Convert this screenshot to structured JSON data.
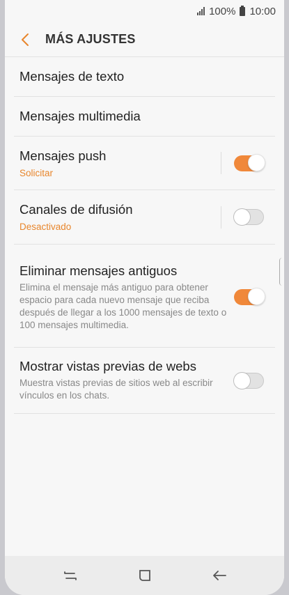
{
  "status_bar": {
    "battery_text": "100%",
    "time": "10:00"
  },
  "header": {
    "title": "MÁS AJUSTES",
    "back_icon": "chevron-left-icon"
  },
  "accent_color": "#f0883a",
  "settings": {
    "text_messages": {
      "title": "Mensajes de texto"
    },
    "multimedia_messages": {
      "title": "Mensajes multimedia"
    },
    "push_messages": {
      "title": "Mensajes push",
      "subtitle": "Solicitar",
      "enabled": true
    },
    "broadcast_channels": {
      "title": "Canales de difusión",
      "subtitle": "Desactivado",
      "enabled": false
    },
    "delete_old_messages": {
      "title": "Eliminar mensajes antiguos",
      "description": "Elimina el mensaje más antiguo para obtener espacio para cada nuevo mensaje que reciba después de llegar a los 1000 mensajes de texto o 100 mensajes multimedia.",
      "enabled": true
    },
    "web_previews": {
      "title": "Mostrar vistas previas de webs",
      "description": "Muestra vistas previas de sitios web al escribir vínculos en los chats.",
      "enabled": false
    }
  },
  "nav_bar": {
    "icons": [
      "recent-apps-icon",
      "home-icon",
      "back-icon"
    ]
  }
}
